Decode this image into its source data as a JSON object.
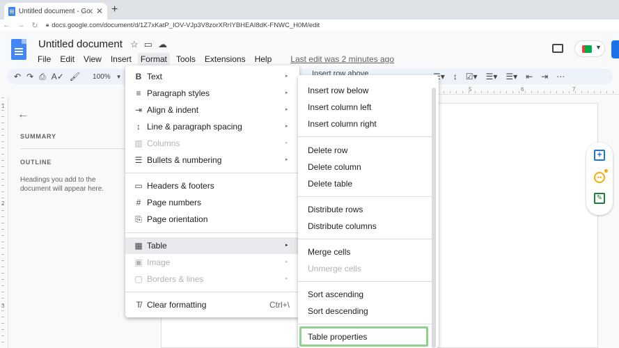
{
  "browser": {
    "tab_title": "Untitled document - Google Do",
    "tab_close": "✕",
    "new_tab": "+",
    "url": "docs.google.com/document/d/1Z7xKatP_IOV-VJp3V8zorXRrIYBHEAI8dK-FNWC_H0M/edit"
  },
  "header": {
    "doc_title": "Untitled document",
    "menus": [
      "File",
      "Edit",
      "View",
      "Insert",
      "Format",
      "Tools",
      "Extensions",
      "Help"
    ],
    "last_edit": "Last edit was 2 minutes ago"
  },
  "toolbar": {
    "zoom": "100%",
    "covered_text": "Insert row above",
    "more": "⋯"
  },
  "ruler": {
    "numbers": [
      "5",
      "6",
      "7"
    ]
  },
  "vruler": {
    "numbers": [
      "1",
      "2",
      "3"
    ]
  },
  "outline": {
    "summary_label": "SUMMARY",
    "outline_label": "OUTLINE",
    "hint": "Headings you add to the document will appear here."
  },
  "format_menu": {
    "items": [
      {
        "label": "Text",
        "icon": "B",
        "arrow": "▸"
      },
      {
        "label": "Paragraph styles",
        "icon": "≡",
        "arrow": "▸"
      },
      {
        "label": "Align & indent",
        "icon": "⇥",
        "arrow": "▸"
      },
      {
        "label": "Line & paragraph spacing",
        "icon": "↕",
        "arrow": "▸"
      },
      {
        "label": "Columns",
        "icon": "▥",
        "arrow": "▸"
      },
      {
        "label": "Bullets & numbering",
        "icon": "☰",
        "arrow": "▸"
      },
      {
        "label": "Headers & footers",
        "icon": "▭"
      },
      {
        "label": "Page numbers",
        "icon": "#"
      },
      {
        "label": "Page orientation",
        "icon": "⎘"
      },
      {
        "label": "Table",
        "icon": "▦",
        "arrow": "▸"
      },
      {
        "label": "Image",
        "icon": "▣",
        "arrow": "▸"
      },
      {
        "label": "Borders & lines",
        "icon": "▢",
        "arrow": "▸"
      },
      {
        "label": "Clear formatting",
        "icon": "T̸",
        "shortcut": "Ctrl+\\"
      }
    ]
  },
  "table_submenu": {
    "items": [
      {
        "label": "Insert row below"
      },
      {
        "label": "Insert column left"
      },
      {
        "label": "Insert column right"
      },
      {
        "label": "Delete row"
      },
      {
        "label": "Delete column"
      },
      {
        "label": "Delete table"
      },
      {
        "label": "Distribute rows"
      },
      {
        "label": "Distribute columns"
      },
      {
        "label": "Merge cells"
      },
      {
        "label": "Unmerge cells"
      },
      {
        "label": "Sort ascending"
      },
      {
        "label": "Sort descending"
      },
      {
        "label": "Table properties"
      }
    ]
  },
  "colors": {
    "accent": "#1a73e8",
    "highlight_border": "#8fd18f",
    "menu_hover": "#e8eaed"
  }
}
